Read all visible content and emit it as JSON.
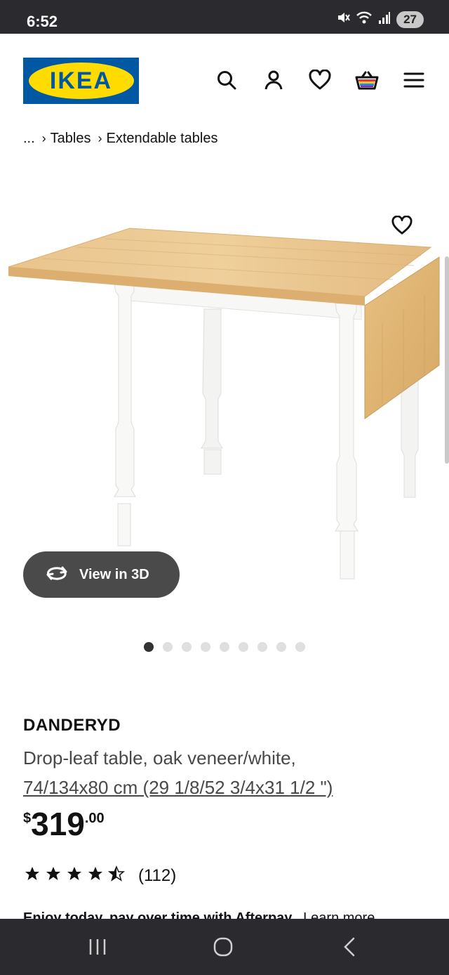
{
  "status_bar": {
    "time": "6:52",
    "battery": "27",
    "icons": [
      "mute-icon",
      "wifi-icon",
      "signal-icon"
    ]
  },
  "header": {
    "logo_text": "IKEA",
    "icons": [
      "search-icon",
      "account-icon",
      "heart-icon",
      "cart-icon",
      "menu-icon"
    ]
  },
  "breadcrumb": {
    "ellipsis": "...",
    "items": [
      "Tables",
      "Extendable tables"
    ]
  },
  "gallery": {
    "view_3d_label": "View in 3D",
    "image_count": 9,
    "active_index": 0
  },
  "product": {
    "name": "DANDERYD",
    "description_line1": "Drop-leaf table, oak veneer/white,",
    "dimensions": "74/134x80 cm (29 1/8/52 3/4x31 1/2 \")",
    "price": {
      "currency": "$",
      "integer": "319",
      "decimal": ".00"
    },
    "rating": {
      "stars": 4.5,
      "count": "(112)"
    }
  },
  "afterpay": {
    "text": "Enjoy today, pay over time with Afterpay.",
    "link": "Learn more"
  },
  "colors": {
    "ikea_blue": "#0058a3",
    "ikea_yellow": "#ffdb00",
    "system_bar": "#2b2b2f"
  }
}
